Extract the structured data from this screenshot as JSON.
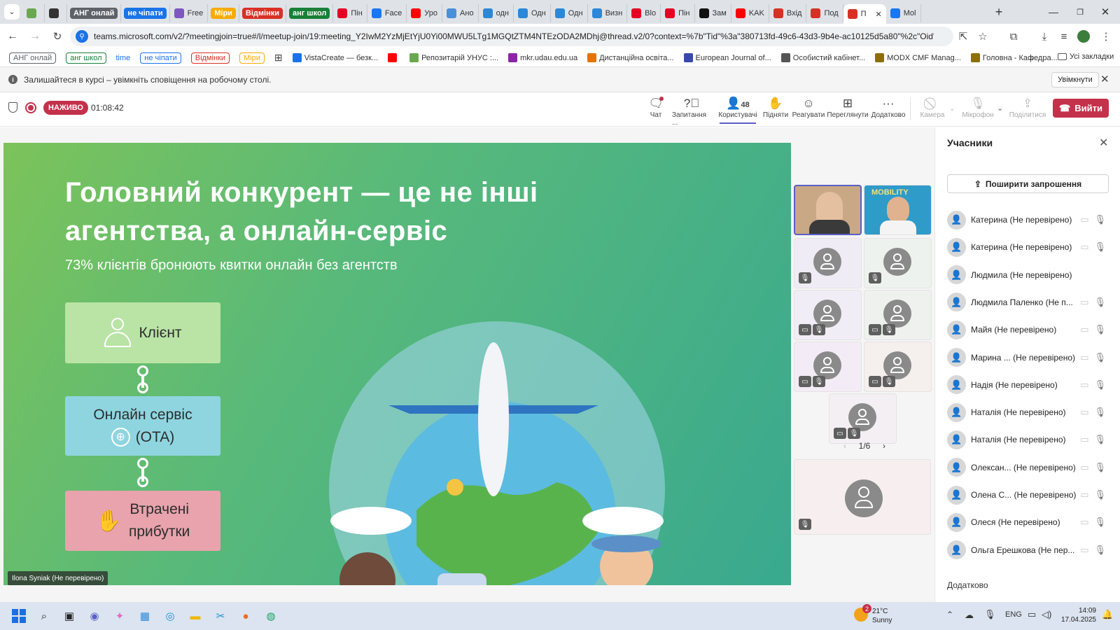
{
  "browser": {
    "tabs": [
      {
        "label": "",
        "icon": "document-icon",
        "color": "#6aa84f"
      },
      {
        "label": "",
        "icon": "circle-icon",
        "color": "#333333"
      },
      {
        "label": "АНГ онлай",
        "pill": true,
        "color": "#5f6368"
      },
      {
        "label": "не чіпати",
        "pill": true,
        "color": "#1a73e8"
      },
      {
        "label": "Free",
        "icon": "v-icon",
        "color": "#7e57c2"
      },
      {
        "label": "Міри",
        "pill": true,
        "color": "#f9ab00"
      },
      {
        "label": "Відмінки",
        "pill": true,
        "color": "#d93025"
      },
      {
        "label": "анг школ",
        "pill": true,
        "color": "#188038"
      },
      {
        "label": "Пін",
        "icon": "pinterest-icon",
        "color": "#e60023"
      },
      {
        "label": "Face",
        "icon": "facebook-icon",
        "color": "#1877f2"
      },
      {
        "label": "Уро",
        "icon": "youtube-icon",
        "color": "#ff0000"
      },
      {
        "label": "Ано",
        "icon": "app-icon",
        "color": "#4a90d9"
      },
      {
        "label": "одн",
        "icon": "grid-icon",
        "color": "#2b88d8"
      },
      {
        "label": "Одн",
        "icon": "grid-icon",
        "color": "#2b88d8"
      },
      {
        "label": "Одн",
        "icon": "grid-icon",
        "color": "#2b88d8"
      },
      {
        "label": "Визн",
        "icon": "grid-icon",
        "color": "#2b88d8"
      },
      {
        "label": "Blo",
        "icon": "pinterest-icon",
        "color": "#e60023"
      },
      {
        "label": "Пін",
        "icon": "pinterest-icon",
        "color": "#e60023"
      },
      {
        "label": "Зам",
        "icon": "h-icon",
        "color": "#111111"
      },
      {
        "label": "KAK",
        "icon": "youtube-icon",
        "color": "#ff0000"
      },
      {
        "label": "Вхід",
        "icon": "gmail-icon",
        "color": "#d93025"
      },
      {
        "label": "Под",
        "icon": "gmail-icon",
        "color": "#d93025"
      },
      {
        "label": "П",
        "icon": "record-icon",
        "color": "#d93025",
        "active": true
      },
      {
        "label": "Mol",
        "icon": "facebook-icon",
        "color": "#1877f2"
      }
    ],
    "url": "teams.microsoft.com/v2/?meetingjoin=true#/l/meetup-join/19:meeting_Y2IwM2YzMjEtYjU0Yi00MWU5LTg1MGQtZTM4NTEzODA2MDhj@thread.v2/0?context=%7b\"Tid\"%3a\"380713fd-49c6-43d3-9b4e-ac10125d5a80\"%2c\"Oid\"%3a\"6f1e3...",
    "bookmarks": [
      {
        "label": "АНГ онлай",
        "pill": true,
        "color": "#5f6368"
      },
      {
        "label": "анг школ",
        "pill": true,
        "color": "#188038"
      },
      {
        "label": "time",
        "pill": false,
        "color": "#1a73e8"
      },
      {
        "label": "не чіпати",
        "pill": true,
        "color": "#1a73e8"
      },
      {
        "label": "Відмінки",
        "pill": true,
        "color": "#d93025"
      },
      {
        "label": "Міри",
        "pill": true,
        "color": "#f9ab00"
      },
      {
        "label": "VistaCreate — безк...",
        "icon": "v-icon",
        "color": "#1a73e8"
      },
      {
        "label": "",
        "icon": "youtube-icon",
        "color": "#ff0000"
      },
      {
        "label": "Репозитарій УНУС :...",
        "icon": "repo-icon",
        "color": "#6aa84f"
      },
      {
        "label": "mkr.udau.edu.ua",
        "icon": "globe-icon",
        "color": "#8e24aa"
      },
      {
        "label": "Дистанційна освіта...",
        "icon": "home-icon",
        "color": "#e37400"
      },
      {
        "label": "European Journal of...",
        "icon": "circle-icon",
        "color": "#3949ab"
      },
      {
        "label": "Особистий кабінет...",
        "icon": "globe-icon",
        "color": "#555555"
      },
      {
        "label": "MODX CMF Manag...",
        "icon": "modx-icon",
        "color": "#8d6e00"
      },
      {
        "label": "Головна - Кафедра...",
        "icon": "modx-icon",
        "color": "#8d6e00"
      }
    ],
    "all_bookmarks": "Усі закладки"
  },
  "notification": {
    "text": "Залишайтеся в курсі – увімкніть сповіщення на робочому столі.",
    "button": "Увімкнути"
  },
  "meeting": {
    "live_label": "НАЖИВО",
    "timer": "01:08:42",
    "participant_count": "48",
    "toolbar": [
      {
        "label": "Чат",
        "icon": "chat-icon"
      },
      {
        "label": "Запитання ...",
        "icon": "qa-icon"
      },
      {
        "label": "Користувачі",
        "icon": "people-icon"
      },
      {
        "label": "Підняти",
        "icon": "hand-icon"
      },
      {
        "label": "Реагувати",
        "icon": "smile-icon"
      },
      {
        "label": "Переглянути",
        "icon": "view-icon"
      },
      {
        "label": "Додатково",
        "icon": "more-icon"
      },
      {
        "label": "Камера",
        "icon": "camera-icon"
      },
      {
        "label": "Мікрофон",
        "icon": "mic-icon"
      },
      {
        "label": "Поділитися",
        "icon": "share-icon"
      }
    ],
    "leave_label": "Вийти"
  },
  "slide": {
    "title_line1": "Головний конкурент — це не інші",
    "title_line2": "агентства, а онлайн-сервіс",
    "subtitle": "73% клієнтів бронюють квитки онлайн без агентств",
    "cards": [
      {
        "label": "Клієнт",
        "icon": "person-icon",
        "color": "#b9e4a5"
      },
      {
        "label_line1": "Онлайн сервіс",
        "label_line2": "(OTA)",
        "icon": "globe-icon",
        "color": "#8fd5e0"
      },
      {
        "label_line1": "Втрачені",
        "label_line2": "прибутки",
        "icon": "hand-money-icon",
        "color": "#e8a3ad"
      }
    ],
    "presenter_label": "Ilona Syniak (Не перевірено)",
    "mobility_text": "MOBILITY"
  },
  "gallery": {
    "page": "1/6"
  },
  "panel": {
    "title": "Учасники",
    "invite": "Поширити запрошення",
    "participants": [
      "Катерина (Не перевірено)",
      "Катерина (Не перевірено)",
      "Людмила (Не перевірено)",
      "Людмила Паленко (Не п...",
      "Майя (Не перевірено)",
      "Марина ... (Не перевірено)",
      "Надія (Не перевірено)",
      "Наталія (Не перевірено)",
      "Наталія (Не перевірено)",
      "Олексан... (Не перевірено)",
      "Олена С... (Не перевірено)",
      "Олеся (Не перевірено)",
      "Ольга Ерешкова (Не пер..."
    ],
    "more": "Додатково"
  },
  "taskbar": {
    "weather_temp": "21°C",
    "weather_desc": "Sunny",
    "weather_badge": "2",
    "lang": "ENG",
    "time": "14:09",
    "date": "17.04.2025"
  },
  "colors": {
    "teams_accent": "#5b5fc7",
    "leave_red": "#c4314b",
    "live_red": "#c4314b"
  }
}
